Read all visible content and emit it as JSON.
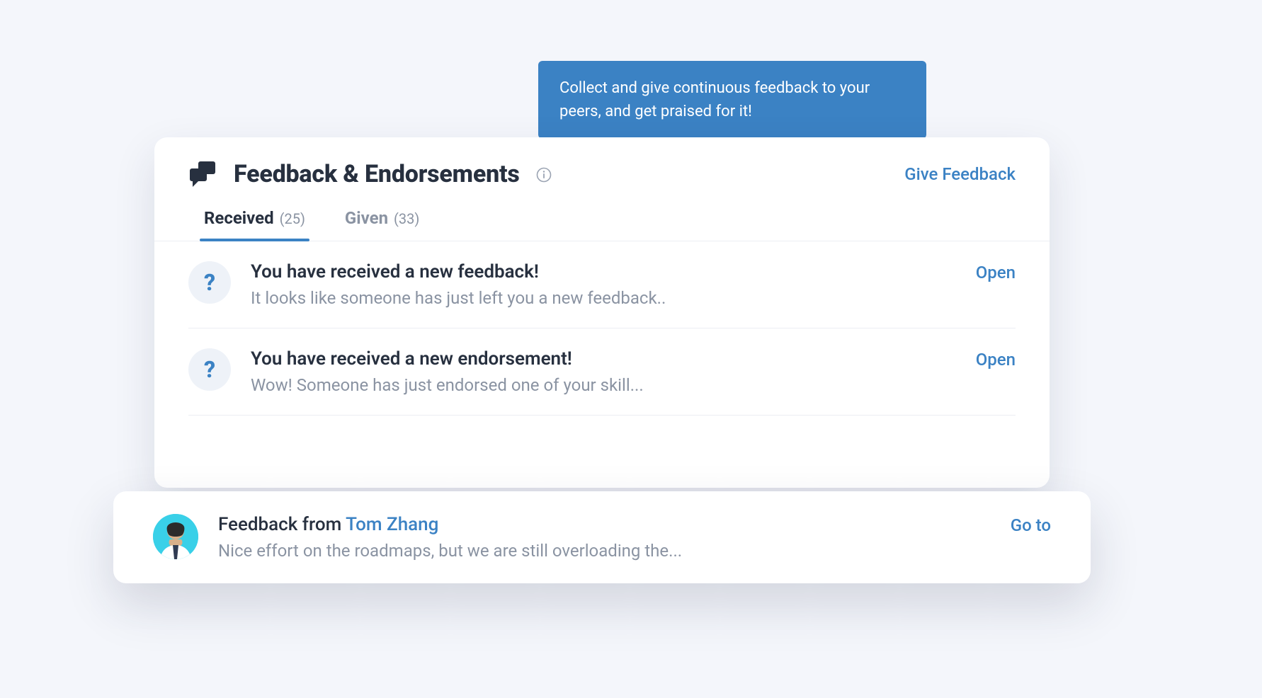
{
  "callout": {
    "text": "Collect and give continuous feedback to your peers, and get praised for it!"
  },
  "header": {
    "title": "Feedback & Endorsements",
    "action": "Give Feedback"
  },
  "tabs": {
    "received": {
      "label": "Received",
      "count": "(25)"
    },
    "given": {
      "label": "Given",
      "count": "(33)"
    }
  },
  "rows": [
    {
      "title": "You have received a new feedback!",
      "subtitle": "It looks like someone has just left you a new feedback..",
      "action": "Open"
    },
    {
      "title": "You have received a new endorsement!",
      "subtitle": "Wow! Someone has just endorsed one of your skill...",
      "action": "Open"
    }
  ],
  "highlight": {
    "prefix": "Feedback from ",
    "person": "Tom Zhang",
    "subtitle": "Nice effort on the roadmaps, but we are still overloading the...",
    "action": "Go to"
  },
  "icons": {
    "question": "?"
  }
}
